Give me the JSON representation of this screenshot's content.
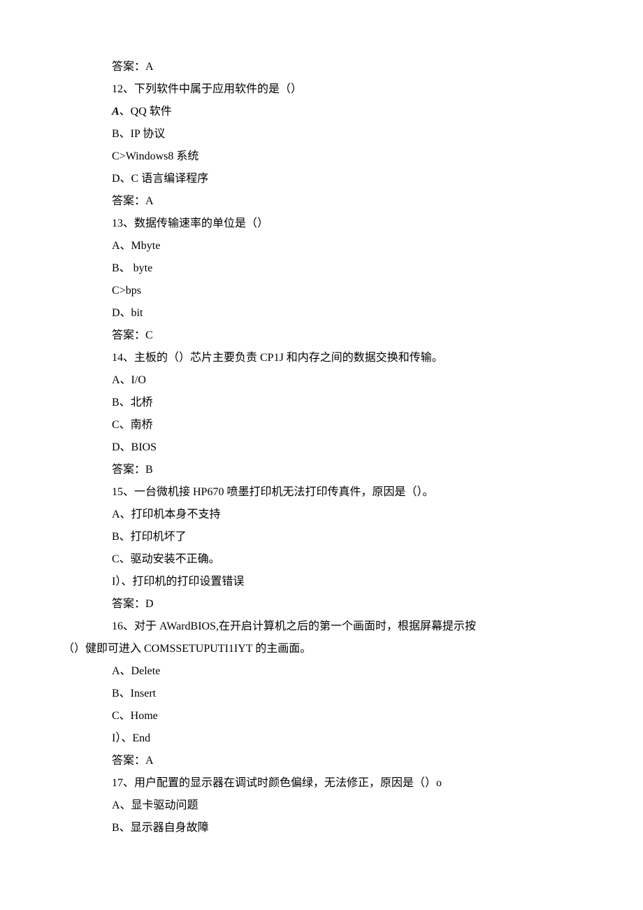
{
  "lines": [
    {
      "indent": 1,
      "text": "答案：A"
    },
    {
      "indent": 1,
      "text": "12、下列软件中属于应用软件的是（）"
    },
    {
      "indent": 1,
      "html": "<span class=\"bold-italic\">A</span>、QQ 软件"
    },
    {
      "indent": 1,
      "text": "B、IP 协议"
    },
    {
      "indent": 1,
      "text": "C>Windows8 系统"
    },
    {
      "indent": 1,
      "text": "D、C 语言编译程序"
    },
    {
      "indent": 1,
      "text": "答案：A"
    },
    {
      "indent": 1,
      "text": "13、数据传输速率的单位是（）"
    },
    {
      "indent": 1,
      "text": "A、Mbyte"
    },
    {
      "indent": 1,
      "text": "B、 byte"
    },
    {
      "indent": 1,
      "text": "C>bps"
    },
    {
      "indent": 1,
      "text": "D、bit"
    },
    {
      "indent": 1,
      "text": "答案：C"
    },
    {
      "indent": 1,
      "text": "14、主板的（）芯片主要负责 CP1J 和内存之间的数据交换和传输。"
    },
    {
      "indent": 1,
      "text": "A、I/O"
    },
    {
      "indent": 1,
      "text": "B、北桥"
    },
    {
      "indent": 1,
      "text": "C、南桥"
    },
    {
      "indent": 1,
      "text": "D、BIOS"
    },
    {
      "indent": 1,
      "text": "答案：B"
    },
    {
      "indent": 1,
      "text": "15、一台微机接 HP670 喷墨打印机无法打印传真件，原因是（）。"
    },
    {
      "indent": 1,
      "text": "A、打印机本身不支持"
    },
    {
      "indent": 1,
      "text": "B、打印机坏了"
    },
    {
      "indent": 1,
      "text": "C、驱动安装不正确。"
    },
    {
      "indent": 1,
      "text": "I）、打印机的打印设置错误"
    },
    {
      "indent": 1,
      "text": "答案：D"
    },
    {
      "indent": 1,
      "text": "16、对于 AWardBIOS,在开启计算机之后的第一个画面时，根据屏幕提示按"
    },
    {
      "indent": 0,
      "text": "（）健即可进入 COMSSETUPUTI1IYT 的主画面。"
    },
    {
      "indent": 1,
      "text": "A、Delete"
    },
    {
      "indent": 1,
      "text": "B、Insert"
    },
    {
      "indent": 1,
      "text": "C、Home"
    },
    {
      "indent": 1,
      "text": "I）、End"
    },
    {
      "indent": 1,
      "text": "答案：A"
    },
    {
      "indent": 1,
      "text": "17、用户配置的显示器在调试时颜色偏绿，无法修正，原因是（）o"
    },
    {
      "indent": 1,
      "text": "A、显卡驱动问题"
    },
    {
      "indent": 1,
      "text": "B、显示器自身故障"
    }
  ]
}
